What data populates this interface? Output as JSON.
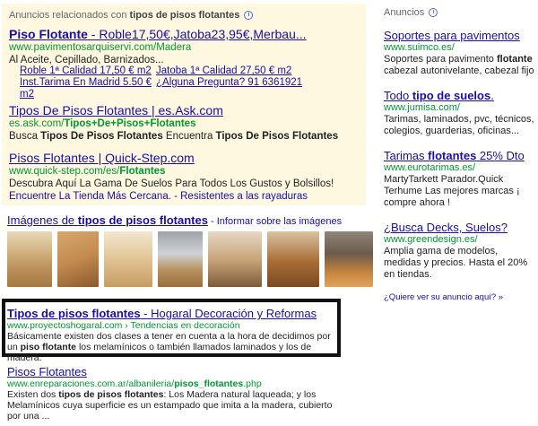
{
  "top_ads": {
    "header": "Anuncios relacionados con",
    "header_bold": "tipos de pisos flotantes",
    "ad1": {
      "title_link": "Piso Flotante",
      "title_rest": " - Roble17,50€,Jatoba23,95€,Merbau...",
      "url": "www.pavimentosarquiservi.com/Madera",
      "snippet": "Al Aceite, Cepillado, Barnizados...",
      "sitelinks": [
        [
          "Roble 1ª Calidad 17,50 € m2",
          "Jatoba 1ª Calidad 27,50 € m2"
        ],
        [
          "Inst.Tarima En Madrid 5.50 € m2",
          "¿Alguna Pregunta? 91 6361921"
        ]
      ]
    },
    "ad2": {
      "title": "Tipos De Pisos Flotantes | es.Ask.com",
      "url_prefix": "es.ask.com/",
      "url_bold": "Tipos+De+Pisos+Flotantes",
      "snippet_plain": "Busca ",
      "snippet_bold": "Tipos De Pisos Flotantes",
      "snippet_rest": " Encuentra ",
      "snippet_bold2": "Tipos De Pisos Flotantes"
    },
    "ad3": {
      "title": "Pisos Flotantes | Quick-Step.com",
      "url_prefix": "www.quick-step.com/es/",
      "url_bold": "Flotantes",
      "snippet": "Descubra Aquí La Gama De Suelos Para Todos Los Gustos y Bolsillos!",
      "links": "Encuentre La Tienda Más Cercana. - Resistentes a las rayaduras"
    }
  },
  "images": {
    "title_plain": "Imágenes de ",
    "title_bold": "tipos de pisos flotantes",
    "report": " - Informar sobre las imágenes"
  },
  "results": {
    "r1": {
      "title_bold": "Tipos de pisos flotantes",
      "title_rest": " - Hogaral Decoración y Reformas",
      "url": "www.proyectoshogaral.com › Tendencias en decoración",
      "snippet_a": "Básicamente existen dos clases a tener en cuenta a la hora de decidimos por un ",
      "snippet_b": "piso flotante",
      "snippet_c": " los melamínicos o también llamados laminados y los de madera."
    },
    "r2": {
      "title": "Pisos Flotantes",
      "url_prefix": "www.enreparaciones.com.ar/albanileria/",
      "url_bold": "pisos_flotantes",
      "url_suffix": ".php",
      "snippet_a": "Existen dos ",
      "snippet_b": "tipos de pisos flotantes",
      "snippet_c": ": Los Madera natural laqueada; y los Melamínicos cuya superficie es un estampado que imita a la madera, cubierto por una ..."
    }
  },
  "right_ads": {
    "header": "Anuncios",
    "ads": [
      {
        "title": "Soportes para pavimentos",
        "url": "www.suimco.es/",
        "snippet_a": "Soportes para pavimento ",
        "snippet_b": "flotante",
        "snippet_c": " cabezal autonivelante, cabezal fijo"
      },
      {
        "title_plain": "Todo ",
        "title_bold": "tipo de suelos",
        "title_end": ".",
        "url": "www.jumisa.com/",
        "snippet": "Tarimas, laminados, pvc, técnicos, colegios, guarderias, oficinas..."
      },
      {
        "title_plain": "Tarimas ",
        "title_bold": "flotantes",
        "title_end": " 25% Dto",
        "url": "www.eurotarimas.es/",
        "snippet": "MartyTarkett Parador.Quick Terhume Las mejores marcas ¡ compre ahora !"
      },
      {
        "title": "¿Busca Decks, Suelos?",
        "url": "www.greendesign.es/",
        "snippet": "Amplia gama de modelos, medidas y precios. Hasta el 20% en tiendas."
      }
    ],
    "more": "¿Quiere ver su anuncio aquí? »"
  },
  "colors": {
    "ad_background": "#fff8e1",
    "link": "#1a0dab",
    "url": "#009933",
    "highlight_border": "#111111"
  }
}
